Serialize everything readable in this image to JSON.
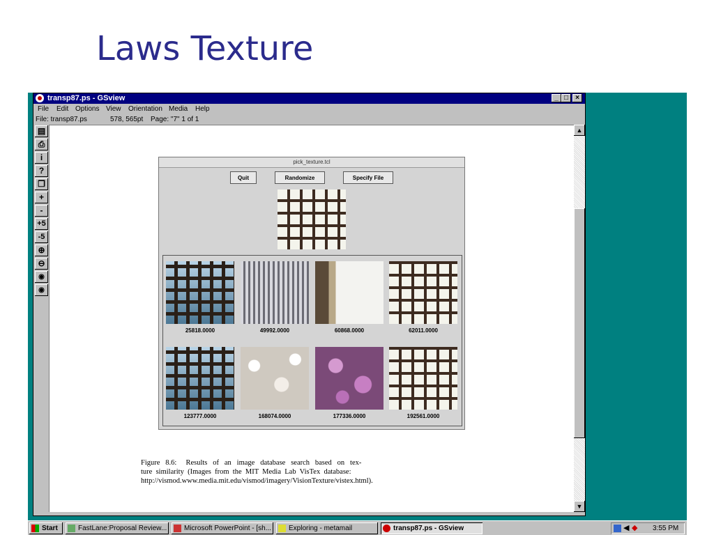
{
  "slide": {
    "title": "Laws Texture"
  },
  "window": {
    "title": "transp87.ps - GSview",
    "menu": [
      "File",
      "Edit",
      "Options",
      "View",
      "Orientation",
      "Media",
      "Help"
    ],
    "status": {
      "file": "File: transp87.ps",
      "coords": "578, 565pt",
      "page": "Page: \"7\"  1 of 1"
    },
    "toolbar": [
      "open-icon",
      "print-icon",
      "i",
      "?",
      "copy-icon",
      "+",
      "-",
      "+5",
      "-5",
      "zoom-in-icon",
      "zoom-out-icon",
      "eye-abc-icon",
      "eye-dots-icon"
    ]
  },
  "panel": {
    "title": "pick_texture.tcl",
    "buttons": {
      "quit": "Quit",
      "randomize": "Randomize",
      "specify": "Specify File"
    },
    "scores": [
      "25818.0000",
      "49992.0000",
      "60868.0000",
      "62011.0000",
      "123777.0000",
      "168074.0000",
      "177336.0000",
      "192561.0000"
    ]
  },
  "caption": {
    "line1": "Figure   8.6:     Results   of   an   image   database   search   based   on   tex-",
    "line2": "ture  similarity  (Images  from  the  MIT  Media  Lab  VisTex  database:",
    "line3": "http://vismod.www.media.mit.edu/vismod/imagery/VisionTexture/vistex.html)."
  },
  "taskbar": {
    "start": "Start",
    "items": [
      "FastLane:Proposal Review...",
      "Microsoft PowerPoint - [sh...",
      "Exploring - metamail",
      "transp87.ps - GSview"
    ],
    "clock": "3:55 PM"
  },
  "colors": {
    "title_blue": "#2b2b8c",
    "desktop_teal": "#008080",
    "titlebar_navy": "#000080"
  }
}
